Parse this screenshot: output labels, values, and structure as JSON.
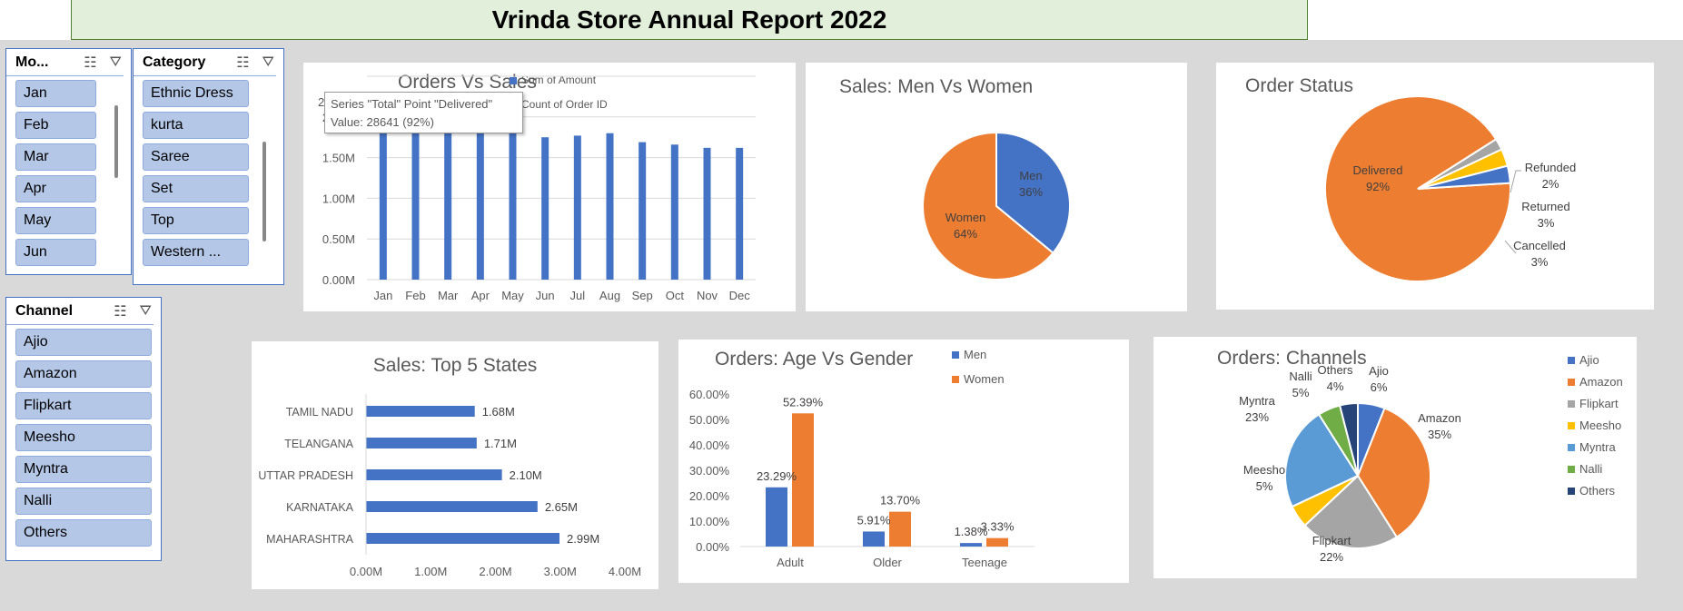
{
  "report": {
    "title": "Vrinda Store Annual Report 2022"
  },
  "slicers": {
    "month": {
      "title": "Mo...",
      "items": [
        "Jan",
        "Feb",
        "Mar",
        "Apr",
        "May",
        "Jun"
      ]
    },
    "category": {
      "title": "Category",
      "items": [
        "Ethnic Dress",
        "kurta",
        "Saree",
        "Set",
        "Top",
        "Western ..."
      ]
    },
    "channel": {
      "title": "Channel",
      "items": [
        "Ajio",
        "Amazon",
        "Flipkart",
        "Meesho",
        "Myntra",
        "Nalli",
        "Others"
      ]
    }
  },
  "icons": {
    "multiselect": "multi-select-icon",
    "clear": "clear-filter-icon"
  },
  "colors": {
    "blue": "#4472c4",
    "orange": "#ed7d31",
    "gray": "#a5a5a5",
    "gold": "#ffc000",
    "lightblue": "#5b9bd5",
    "green": "#70ad47",
    "navy": "#264478"
  },
  "tooltip": {
    "line1": "Series \"Total\" Point \"Delivered\"",
    "line2": "Value: 28641 (92%)"
  },
  "chart_data": [
    {
      "id": "orders_vs_sales",
      "type": "bar",
      "title": "Orders Vs Sales",
      "legend": [
        "Sum of Amount",
        "Count of Order ID"
      ],
      "partial_tick": "2",
      "categories": [
        "Jan",
        "Feb",
        "Mar",
        "Apr",
        "May",
        "Jun",
        "Jul",
        "Aug",
        "Sep",
        "Oct",
        "Nov",
        "Dec"
      ],
      "series": [
        {
          "name": "Sum of Amount",
          "values": [
            1.82,
            1.88,
            1.93,
            1.82,
            1.8,
            1.75,
            1.77,
            1.8,
            1.69,
            1.66,
            1.62,
            1.62
          ]
        }
      ],
      "yticks": [
        "0.00M",
        "0.50M",
        "1.00M",
        "1.50M",
        "2.00M"
      ],
      "ylim": [
        0,
        2.5
      ]
    },
    {
      "id": "sales_gender",
      "type": "pie",
      "title": "Sales: Men Vs Women",
      "slices": [
        {
          "label": "Men",
          "pct": "36%",
          "value": 36
        },
        {
          "label": "Women",
          "pct": "64%",
          "value": 64
        }
      ]
    },
    {
      "id": "order_status",
      "type": "pie",
      "title": "Order Status",
      "slices": [
        {
          "label": "Delivered",
          "pct": "92%",
          "value": 92
        },
        {
          "label": "Refunded",
          "pct": "2%",
          "value": 2
        },
        {
          "label": "Returned",
          "pct": "3%",
          "value": 3
        },
        {
          "label": "Cancelled",
          "pct": "3%",
          "value": 3
        }
      ]
    },
    {
      "id": "top_states",
      "type": "bar",
      "orientation": "horizontal",
      "title": "Sales: Top 5 States",
      "categories": [
        "TAMIL NADU",
        "TELANGANA",
        "UTTAR PRADESH",
        "KARNATAKA",
        "MAHARASHTRA"
      ],
      "values": [
        1.68,
        1.71,
        2.1,
        2.65,
        2.99
      ],
      "value_labels": [
        "1.68M",
        "1.71M",
        "2.10M",
        "2.65M",
        "2.99M"
      ],
      "xticks": [
        "0.00M",
        "1.00M",
        "2.00M",
        "3.00M",
        "4.00M"
      ],
      "xlim": [
        0,
        4
      ]
    },
    {
      "id": "age_gender",
      "type": "bar",
      "title": "Orders: Age Vs Gender",
      "categories": [
        "Adult",
        "Older",
        "Teenage"
      ],
      "series": [
        {
          "name": "Men",
          "values": [
            23.29,
            5.91,
            1.38
          ],
          "labels": [
            "23.29%",
            "5.91%",
            "1.38%"
          ]
        },
        {
          "name": "Women",
          "values": [
            52.39,
            13.7,
            3.33
          ],
          "labels": [
            "52.39%",
            "13.70%",
            "3.33%"
          ]
        }
      ],
      "yticks": [
        "0.00%",
        "10.00%",
        "20.00%",
        "30.00%",
        "40.00%",
        "50.00%",
        "60.00%"
      ],
      "ylim": [
        0,
        60
      ]
    },
    {
      "id": "channels",
      "type": "pie",
      "title": "Orders: Channels",
      "slices": [
        {
          "label": "Ajio",
          "pct": "6%",
          "value": 6
        },
        {
          "label": "Amazon",
          "pct": "35%",
          "value": 35
        },
        {
          "label": "Flipkart",
          "pct": "22%",
          "value": 22
        },
        {
          "label": "Meesho",
          "pct": "5%",
          "value": 5
        },
        {
          "label": "Myntra",
          "pct": "23%",
          "value": 23
        },
        {
          "label": "Nalli",
          "pct": "5%",
          "value": 5
        },
        {
          "label": "Others",
          "pct": "4%",
          "value": 4
        }
      ],
      "legend": [
        "Ajio",
        "Amazon",
        "Flipkart",
        "Meesho",
        "Myntra",
        "Nalli",
        "Others"
      ]
    }
  ]
}
